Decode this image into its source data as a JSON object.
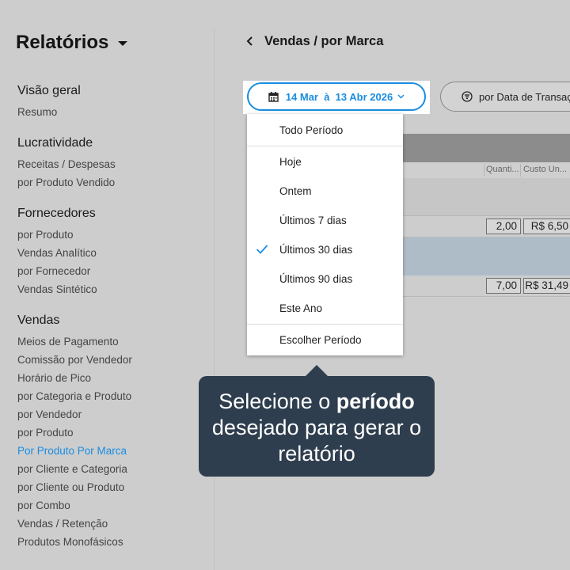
{
  "sidebar": {
    "title": "Relatórios",
    "groups": [
      {
        "heading": "Visão geral",
        "items": [
          {
            "label": "Resumo"
          }
        ]
      },
      {
        "heading": "Lucratividade",
        "items": [
          {
            "label": "Receitas / Despesas"
          },
          {
            "label": "por Produto Vendido"
          }
        ]
      },
      {
        "heading": "Fornecedores",
        "items": [
          {
            "label": "por Produto"
          },
          {
            "label": "Vendas Analítico"
          },
          {
            "label": "por Fornecedor"
          },
          {
            "label": "Vendas Sintético"
          }
        ]
      },
      {
        "heading": "Vendas",
        "items": [
          {
            "label": "Meios de Pagamento"
          },
          {
            "label": "Comissão por Vendedor"
          },
          {
            "label": "Horário de Pico"
          },
          {
            "label": "por Categoria e Produto"
          },
          {
            "label": "por Vendedor"
          },
          {
            "label": "por Produto"
          },
          {
            "label": "Por Produto Por Marca",
            "active": true
          },
          {
            "label": "por Cliente e Categoria"
          },
          {
            "label": "por Cliente ou Produto"
          },
          {
            "label": "por Combo"
          },
          {
            "label": "Vendas / Retenção"
          },
          {
            "label": "Produtos Monofásicos"
          }
        ]
      }
    ]
  },
  "header": {
    "title": "Vendas / por Marca",
    "back_icon": "chevron-left-icon"
  },
  "date_range": {
    "label": "14 Mar  à  13 Abr 2026",
    "icon": "calendar-icon",
    "chevron": "chevron-down-icon"
  },
  "filter": {
    "label": "por Data de Transação",
    "icon": "filter-icon"
  },
  "table": {
    "columns": [
      "Quanti...",
      "Custo Un..."
    ],
    "rows": [
      {
        "quantity": "2,00",
        "cost": "R$ 6,50"
      },
      {
        "quantity": "7,00",
        "cost": "R$ 31,49"
      }
    ]
  },
  "dropdown": {
    "items": [
      {
        "label": "Todo Período"
      },
      {
        "label": "Hoje"
      },
      {
        "label": "Ontem"
      },
      {
        "label": "Últimos 7 dias"
      },
      {
        "label": "Últimos 30 dias",
        "selected": true
      },
      {
        "label": "Últimos 90 dias"
      },
      {
        "label": "Este Ano"
      },
      {
        "label": "Escolher Período"
      }
    ]
  },
  "tooltip": {
    "before": "Selecione o ",
    "bold": "período",
    "after": " desejado para gerar o relatório"
  },
  "colors": {
    "accent": "#1a8de0",
    "tooltip_bg": "#2f3e4e",
    "background": "#cdcdcd"
  }
}
